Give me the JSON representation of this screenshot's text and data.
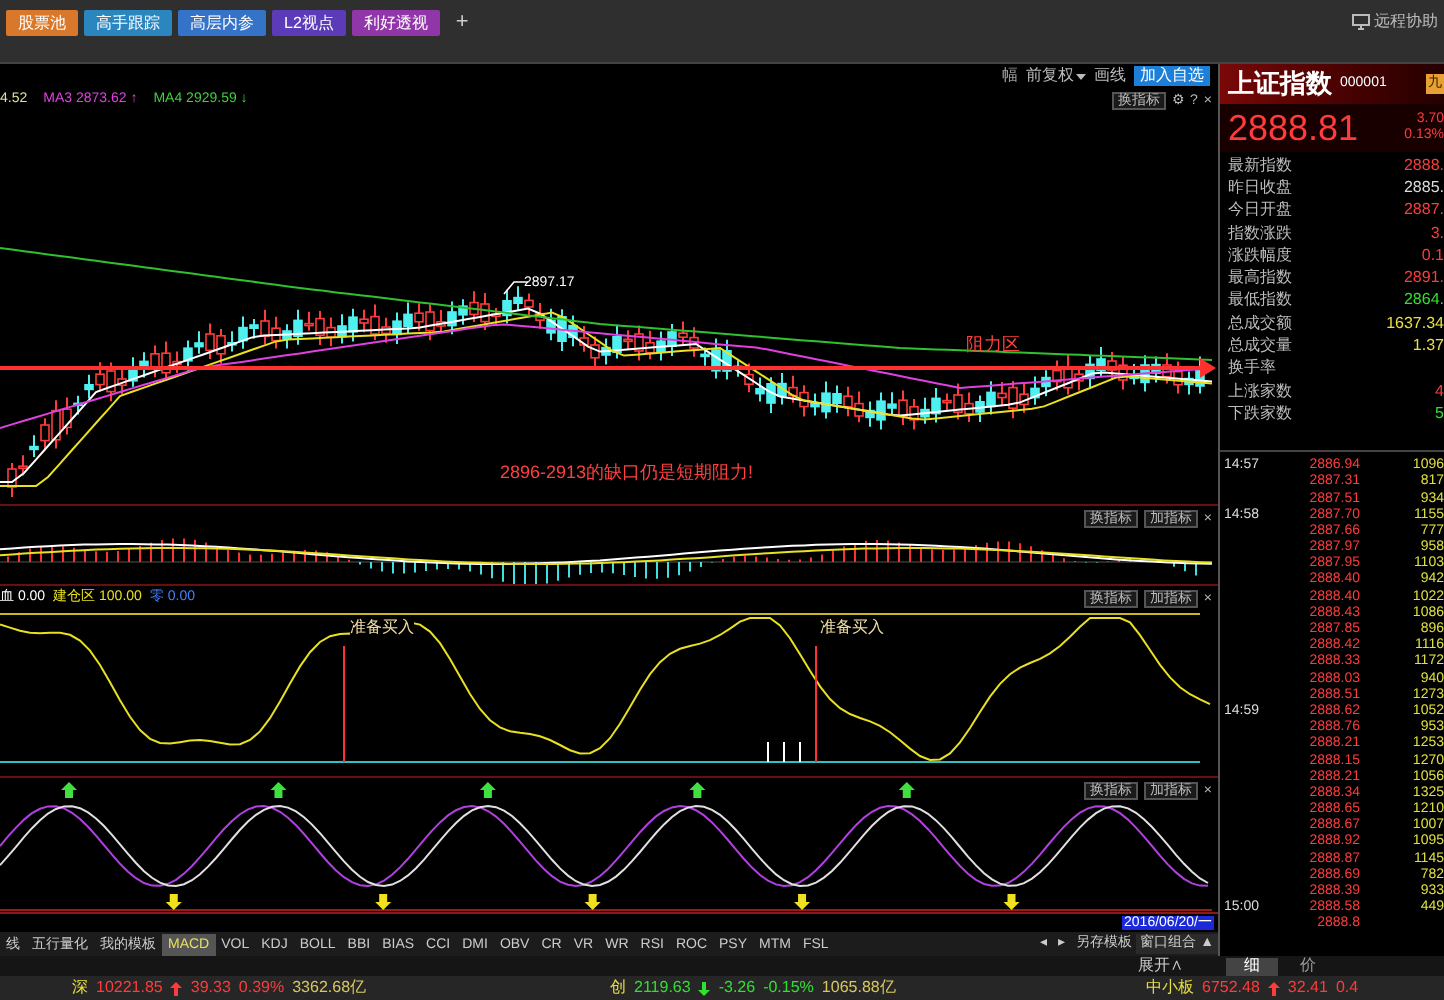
{
  "top_tabs": [
    {
      "label": "股票池",
      "color": "#d9782a"
    },
    {
      "label": "高手跟踪",
      "color": "#2b86c0"
    },
    {
      "label": "高层内参",
      "color": "#3473c8"
    },
    {
      "label": "L2视点",
      "color": "#5b3bb8"
    },
    {
      "label": "利好透视",
      "color": "#9136a8"
    }
  ],
  "add_tab": "+",
  "remote_help": "远程协助",
  "chart_toolbar": {
    "icon_text": "幅",
    "adjust": "前复权",
    "draw": "画线",
    "add_watch": "加入自选"
  },
  "main_chart": {
    "legend": [
      {
        "text": "4.52",
        "color": "#e0e0a0"
      },
      {
        "text": "MA3 2873.62 ↑",
        "color": "#e040e0"
      },
      {
        "text": "MA4 2929.59 ↓",
        "color": "#40d040"
      }
    ],
    "buttons": [
      "换指标",
      "⚙",
      "?",
      "×"
    ],
    "peak_label": "2897.17",
    "zone_label": "阻力区",
    "note": "2896-2913的缺口仍是短期阻力!"
  },
  "panels": [
    {
      "kind": "macd",
      "buttons": [
        "换指标",
        "加指标",
        "×"
      ]
    },
    {
      "kind": "signal",
      "buttons": [
        "换指标",
        "加指标",
        "×"
      ],
      "legend": [
        {
          "text": "血 0.00",
          "color": "#ffffff"
        },
        {
          "text": "建仓区 100.00",
          "color": "#e8e020"
        },
        {
          "text": "零 0.00",
          "color": "#4080ff"
        }
      ],
      "marks": [
        "准备买入",
        "准备买入"
      ]
    },
    {
      "kind": "wave",
      "buttons": [
        "换指标",
        "加指标",
        "×"
      ]
    }
  ],
  "cursor_date": "2016/06/20/一",
  "indicator_tabs": [
    {
      "label": "线",
      "selected": false
    },
    {
      "label": "五行量化",
      "selected": false
    },
    {
      "label": "我的模板",
      "selected": false
    },
    {
      "label": "MACD",
      "selected": true
    },
    {
      "label": "VOL",
      "selected": false
    },
    {
      "label": "KDJ",
      "selected": false
    },
    {
      "label": "BOLL",
      "selected": false
    },
    {
      "label": "BBI",
      "selected": false
    },
    {
      "label": "BIAS",
      "selected": false
    },
    {
      "label": "CCI",
      "selected": false
    },
    {
      "label": "DMI",
      "selected": false
    },
    {
      "label": "OBV",
      "selected": false
    },
    {
      "label": "CR",
      "selected": false
    },
    {
      "label": "VR",
      "selected": false
    },
    {
      "label": "WR",
      "selected": false
    },
    {
      "label": "RSI",
      "selected": false
    },
    {
      "label": "ROC",
      "selected": false
    },
    {
      "label": "PSY",
      "selected": false
    },
    {
      "label": "MTM",
      "selected": false
    },
    {
      "label": "FSL",
      "selected": false
    }
  ],
  "tab_scroll": [
    "◂",
    "▸"
  ],
  "save_template": "另存模板",
  "window_combo": "窗口组合 ▲",
  "expand": "展开∧",
  "quote": {
    "name": "上证指数",
    "code": "000001",
    "badge": "九",
    "price": "2888.81",
    "change": "3.70",
    "change_pct": "0.13%",
    "stats": [
      {
        "label": "最新指数",
        "value": "2888.",
        "color": "#ff3b3b"
      },
      {
        "label": "昨日收盘",
        "value": "2885.",
        "color": "#dddddd"
      },
      {
        "label": "今日开盘",
        "value": "2887.",
        "color": "#ff3b3b"
      },
      {
        "label": "指数涨跌",
        "value": "3.",
        "color": "#ff3b3b"
      },
      {
        "label": "涨跌幅度",
        "value": "0.1",
        "color": "#ff3b3b"
      },
      {
        "label": "最高指数",
        "value": "2891.",
        "color": "#ff3b3b"
      },
      {
        "label": "最低指数",
        "value": "2864.",
        "color": "#30e030"
      },
      {
        "label": "总成交额",
        "value": "1637.34",
        "color": "#e8e040"
      },
      {
        "label": "总成交量",
        "value": "1.37",
        "color": "#e8e040"
      },
      {
        "label": "换手率"
      },
      {
        "label": "上涨家数",
        "value": "4",
        "color": "#ff3b3b"
      },
      {
        "label": "下跌家数",
        "value": "5",
        "color": "#30e030"
      }
    ],
    "ticks": [
      {
        "time": "14:57",
        "price": "2886.94",
        "volume": "1096"
      },
      {
        "price": "2887.31",
        "volume": "817"
      },
      {
        "price": "2887.51",
        "volume": "934"
      },
      {
        "time": "14:58",
        "price": "2887.70",
        "volume": "1155"
      },
      {
        "price": "2887.66",
        "volume": "777"
      },
      {
        "price": "2887.97",
        "volume": "958"
      },
      {
        "price": "2887.95",
        "volume": "1103"
      },
      {
        "price": "2888.40",
        "volume": "942"
      },
      {
        "price": "2888.40",
        "volume": "1022"
      },
      {
        "price": "2888.43",
        "volume": "1086"
      },
      {
        "price": "2887.85",
        "volume": "896"
      },
      {
        "price": "2888.42",
        "volume": "1116"
      },
      {
        "price": "2888.33",
        "volume": "1172"
      },
      {
        "price": "2888.03",
        "volume": "940"
      },
      {
        "price": "2888.51",
        "volume": "1273"
      },
      {
        "time": "14:59",
        "price": "2888.62",
        "volume": "1052"
      },
      {
        "price": "2888.76",
        "volume": "953"
      },
      {
        "price": "2888.21",
        "volume": "1253"
      },
      {
        "price": "2888.15",
        "volume": "1270"
      },
      {
        "price": "2888.21",
        "volume": "1056"
      },
      {
        "price": "2888.34",
        "volume": "1325"
      },
      {
        "price": "2888.65",
        "volume": "1210"
      },
      {
        "price": "2888.67",
        "volume": "1007"
      },
      {
        "price": "2888.92",
        "volume": "1095"
      },
      {
        "price": "2888.87",
        "volume": "1145"
      },
      {
        "price": "2888.69",
        "volume": "782"
      },
      {
        "price": "2888.39",
        "volume": "933"
      },
      {
        "time": "15:00",
        "price": "2888.58",
        "volume": "449"
      },
      {
        "price": "2888.8"
      }
    ],
    "view_tabs": [
      {
        "label": "细",
        "selected": true
      },
      {
        "label": "价",
        "selected": false
      }
    ]
  },
  "status_bar": [
    {
      "market": "深",
      "price": "10221.85",
      "kind": "up",
      "change": "39.33",
      "pct": "0.39%",
      "amount": "3362.68亿"
    },
    {
      "market": "创",
      "price": "2119.63",
      "kind": "down",
      "change": "-3.26",
      "pct": "-0.15%",
      "amount": "1065.88亿"
    },
    {
      "market": "中小板",
      "price": "6752.48",
      "kind": "up",
      "change": "32.41",
      "pct": "0.4"
    }
  ]
}
